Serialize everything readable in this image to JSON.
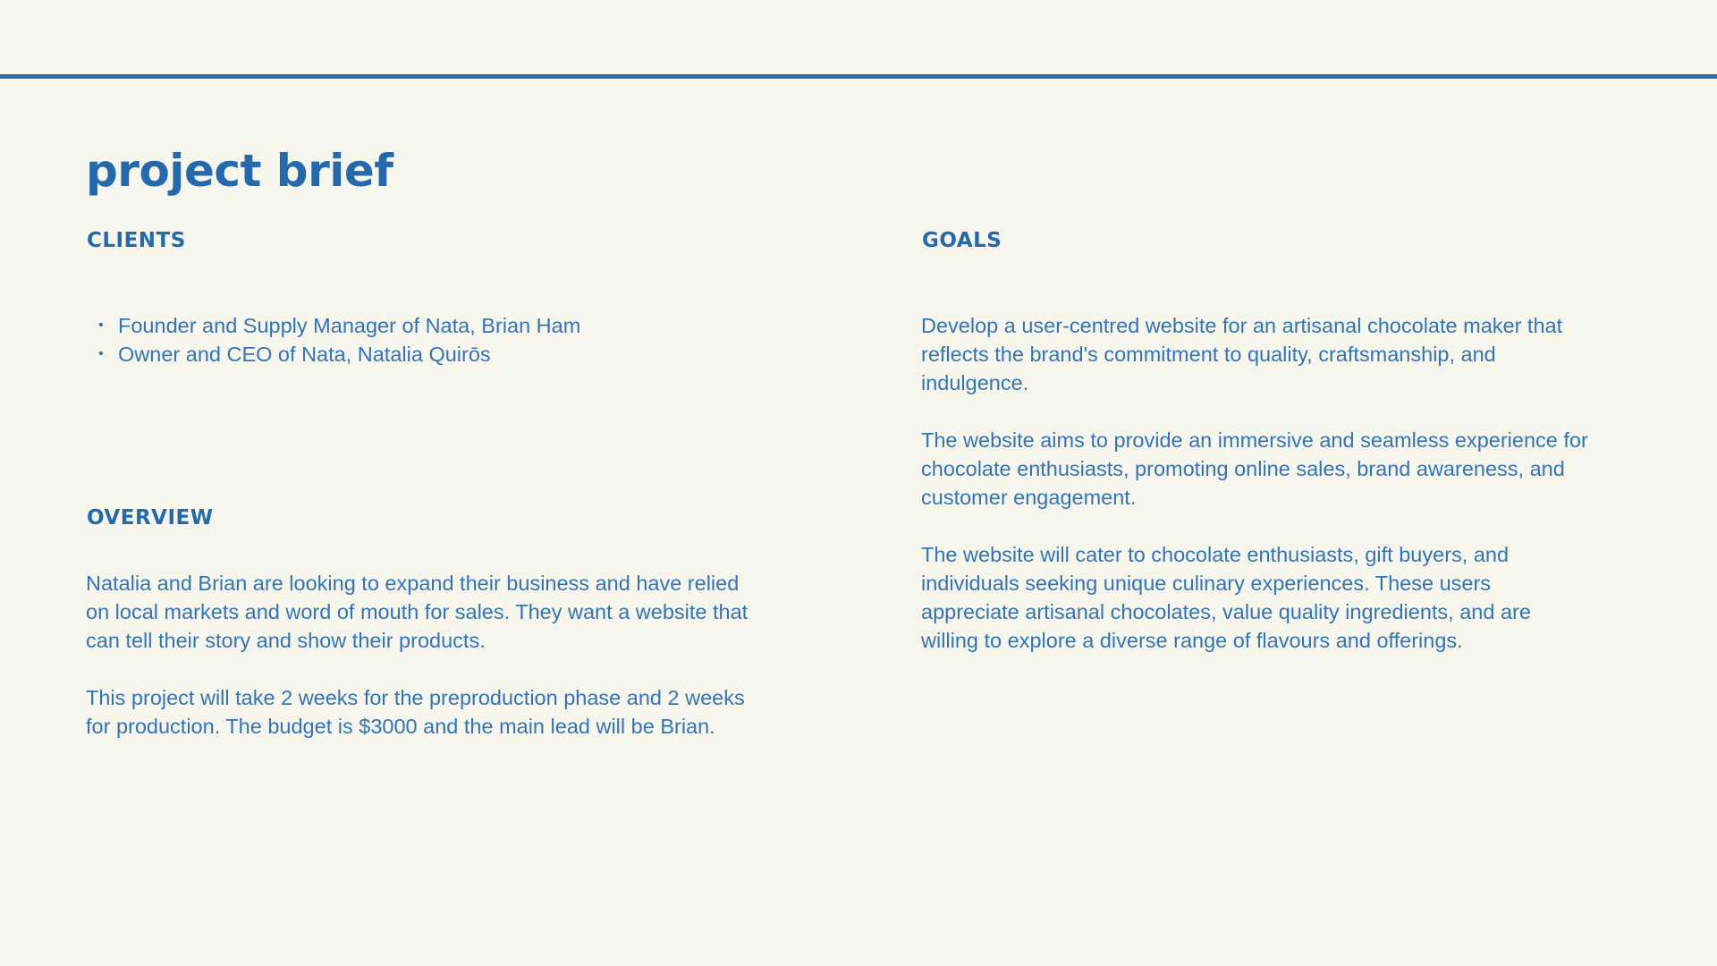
{
  "title": "project brief",
  "clients": {
    "heading": "CLIENTS",
    "items": [
      "Founder and Supply Manager of Nata, Brian Ham",
      "Owner and CEO of Nata, Natalia Quirōs"
    ]
  },
  "overview": {
    "heading": "OVERVIEW",
    "paragraphs": [
      "Natalia and Brian are looking to expand their business and have relied\non local markets and word of mouth for sales. They want a website that\ncan tell their story and show their products.",
      "This project will take 2 weeks for the preproduction phase and 2 weeks\nfor production. The budget is $3000 and the main lead will be Brian."
    ]
  },
  "goals": {
    "heading": "GOALS",
    "paragraphs": [
      "Develop a user-centred website for an artisanal chocolate maker that\nreflects the brand's commitment to quality, craftsmanship, and\nindulgence.",
      "The website aims to provide an immersive and seamless experience for\nchocolate enthusiasts, promoting online sales, brand awareness, and\ncustomer engagement.",
      "The website will cater to chocolate enthusiasts, gift buyers, and\nindividuals seeking unique culinary experiences. These users\nappreciate artisanal chocolates, value quality ingredients, and are\nwilling to explore a diverse range of flavours and offerings."
    ]
  },
  "colors": {
    "background": "#f7f6ec",
    "accent": "#2b6cae"
  }
}
